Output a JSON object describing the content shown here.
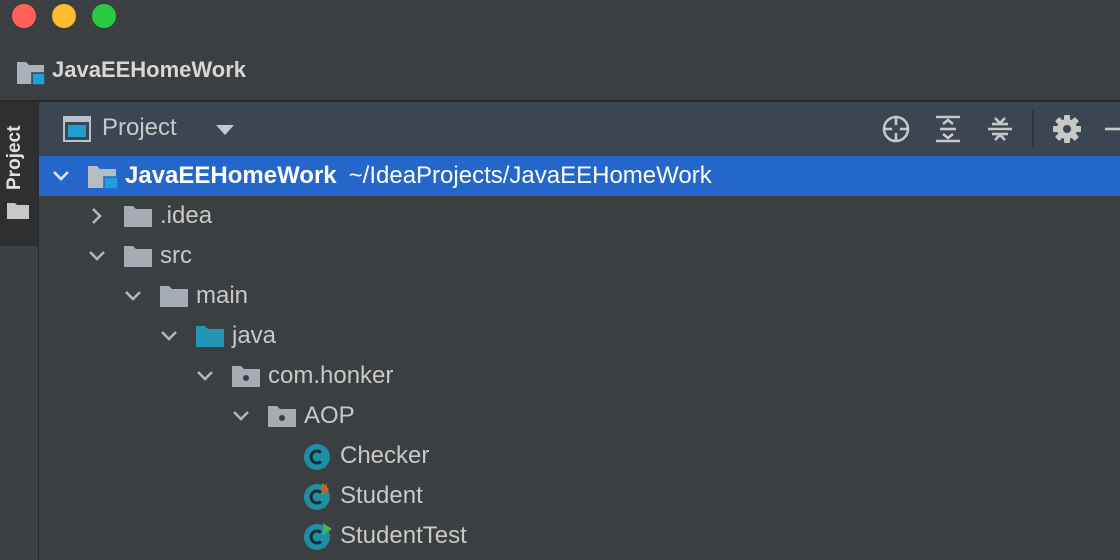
{
  "window": {
    "title": "JavaEEHomeWork"
  },
  "tool_window_strip": {
    "tab_label": "Project"
  },
  "panel_header": {
    "view_label": "Project",
    "tools": [
      "locate-icon",
      "expand-all-icon",
      "collapse-all-icon",
      "gear-icon",
      "minimize-icon"
    ]
  },
  "tree": [
    {
      "name": "JavaEEHomeWork",
      "path": "~/IdeaProjects/JavaEEHomeWork",
      "type": "project",
      "expanded": true,
      "selected": true
    },
    {
      "name": ".idea",
      "type": "folder",
      "expanded": false
    },
    {
      "name": "src",
      "type": "folder",
      "expanded": true
    },
    {
      "name": "main",
      "type": "folder",
      "expanded": true
    },
    {
      "name": "java",
      "type": "source-folder",
      "expanded": true
    },
    {
      "name": "com.honker",
      "type": "package",
      "expanded": true
    },
    {
      "name": "AOP",
      "type": "package",
      "expanded": true
    },
    {
      "name": "Checker",
      "type": "class"
    },
    {
      "name": "Student",
      "type": "class-mixed"
    },
    {
      "name": "StudentTest",
      "type": "class-runnable"
    }
  ],
  "colors": {
    "background": "#3c3f41",
    "header": "#3c4652",
    "selection": "#2466c9",
    "class_icon": "#1d8fa5",
    "source_folder": "#2496b5"
  }
}
